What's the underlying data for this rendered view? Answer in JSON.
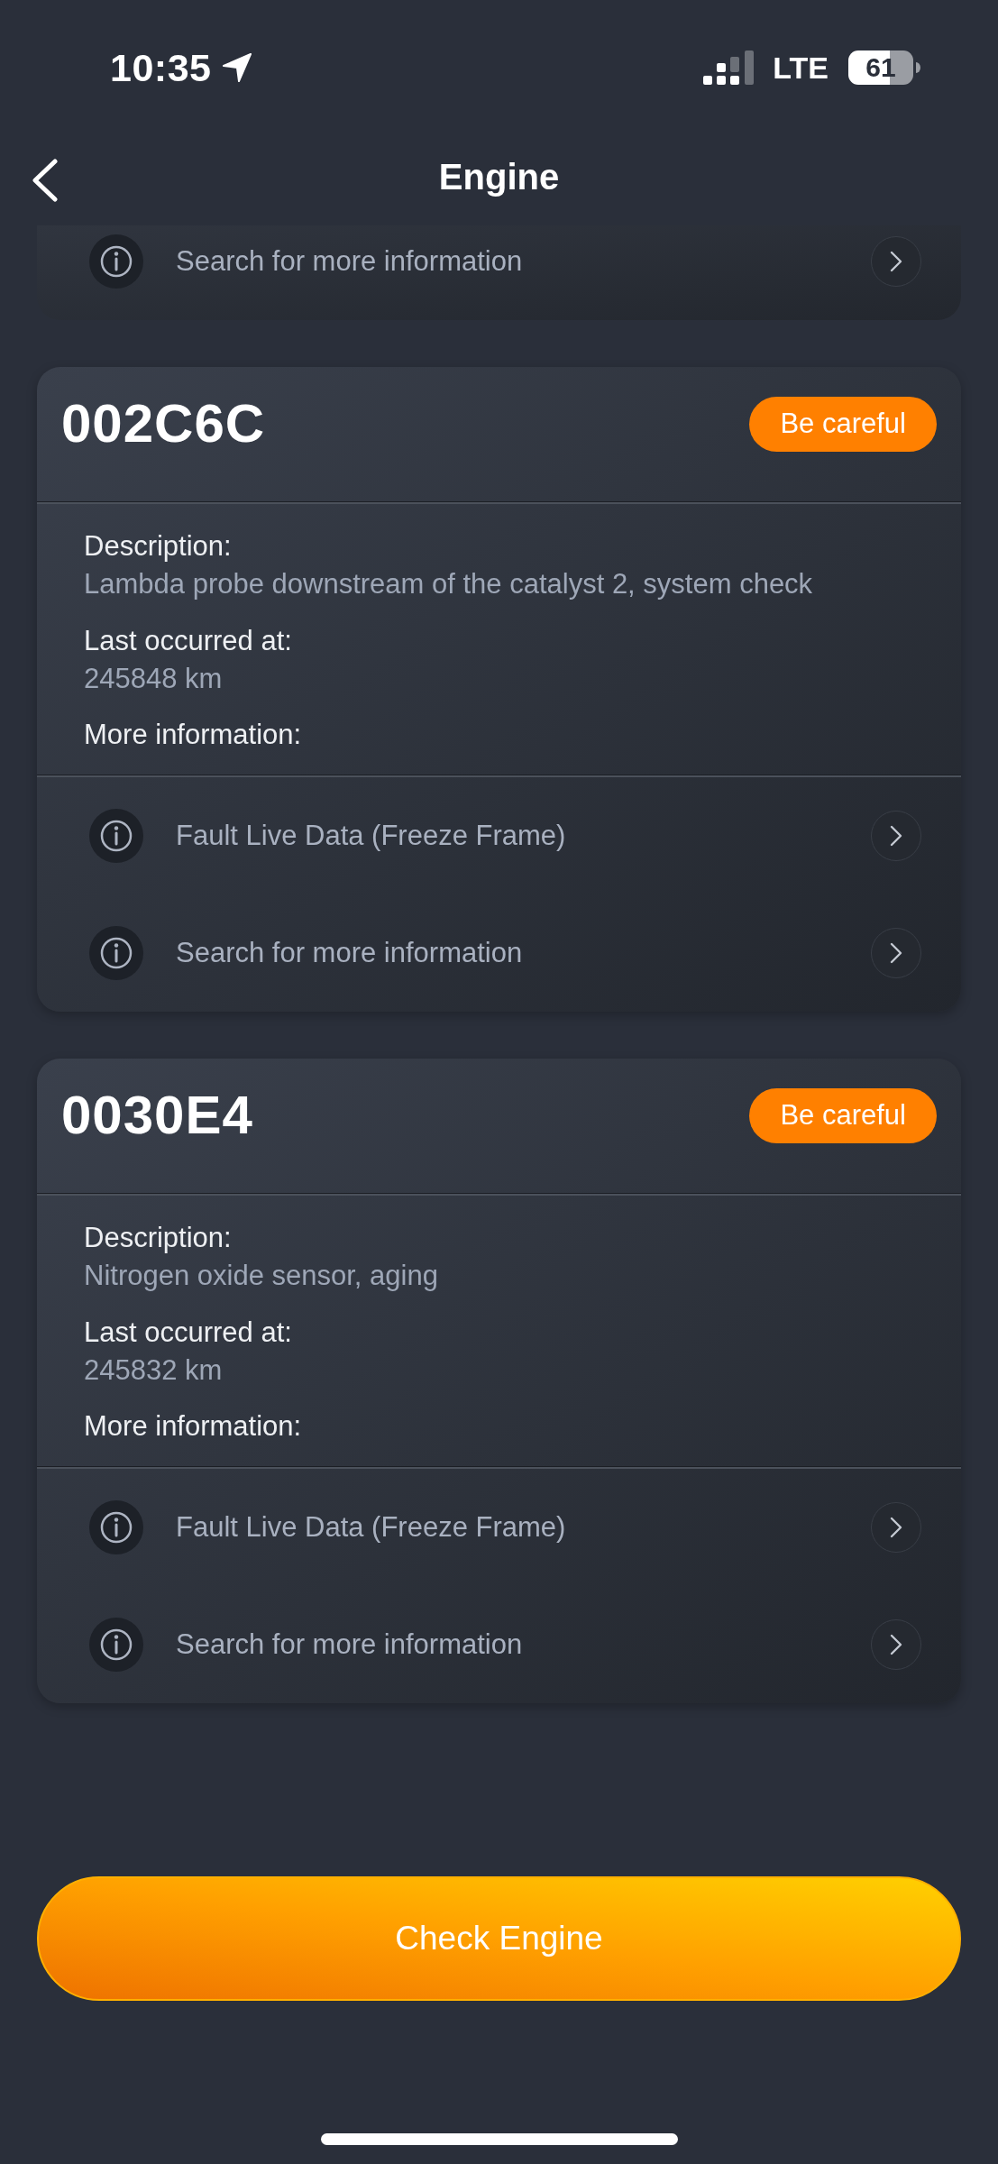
{
  "status_bar": {
    "time": "10:35",
    "network": "LTE",
    "battery": "61"
  },
  "nav": {
    "title": "Engine"
  },
  "previous_fault": {
    "links": [
      {
        "label": "Search for more information"
      }
    ]
  },
  "faults": [
    {
      "code": "002C6C",
      "badge": "Be careful",
      "fields": [
        {
          "label": "Description:",
          "value": "Lambda probe downstream of the catalyst 2, system check"
        },
        {
          "label": "Last occurred at:",
          "value": "245848 km"
        }
      ],
      "more_label": "More information:",
      "links": [
        {
          "label": "Fault Live Data (Freeze Frame)"
        },
        {
          "label": "Search for more information"
        }
      ]
    },
    {
      "code": "0030E4",
      "badge": "Be careful",
      "fields": [
        {
          "label": "Description:",
          "value": "Nitrogen oxide sensor, aging"
        },
        {
          "label": "Last occurred at:",
          "value": "245832 km"
        }
      ],
      "more_label": "More information:",
      "links": [
        {
          "label": "Fault Live Data (Freeze Frame)"
        },
        {
          "label": "Search for more information"
        }
      ]
    }
  ],
  "primary_button": {
    "label": "Check Engine"
  }
}
